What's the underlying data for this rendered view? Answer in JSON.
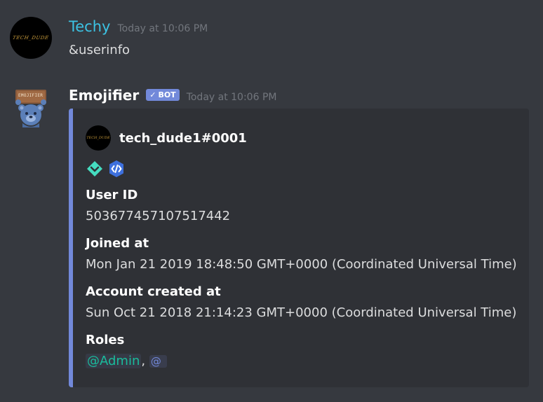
{
  "messages": [
    {
      "author": "Techy",
      "author_color": "#3cc3e4",
      "avatar_text": "TECH_DUDE",
      "timestamp": "Today at 10:06 PM",
      "content": "&userinfo"
    },
    {
      "author": "Emojifier",
      "author_color": "#ffffff",
      "bot_tag": "BOT",
      "bot_check": "✓",
      "avatar_sign": "EMOJIFIER",
      "timestamp": "Today at 10:06 PM"
    }
  ],
  "embed": {
    "border_color": "#7289da",
    "author": {
      "name": "tech_dude1#0001",
      "icon_text": "TECH_DUDE"
    },
    "badges": [
      "hypesquad-balance-icon",
      "early-verified-bot-developer-icon"
    ],
    "fields": [
      {
        "name": "User ID",
        "value": "503677457107517442"
      },
      {
        "name": "Joined at",
        "value": "Mon Jan 21 2019 18:48:50 GMT+0000 (Coordinated Universal Time)"
      },
      {
        "name": "Account created at",
        "value": "Sun Oct 21 2018 21:14:23 GMT+0000 (Coordinated Universal Time)"
      },
      {
        "name": "Roles",
        "roles": [
          "@Admin",
          ",",
          "@"
        ]
      }
    ]
  },
  "colors": {
    "background": "#36393f",
    "embed_background": "#2f3136",
    "role_admin": "#1abc9c",
    "timestamp": "#72767d"
  }
}
